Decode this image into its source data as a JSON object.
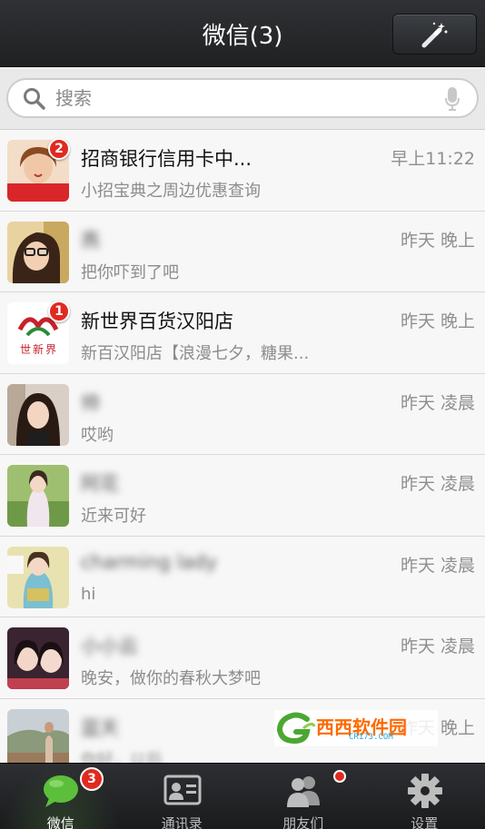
{
  "header": {
    "title": "微信(3)",
    "magic_icon": "magic-wand-icon"
  },
  "search": {
    "placeholder": "搜索",
    "value": "",
    "icon": "search-icon",
    "mic_icon": "microphone-icon"
  },
  "chats": [
    {
      "name": "招商银行信用卡中...",
      "message": "小招宝典之周边优惠查询",
      "time": "早上11:22",
      "badge": "2",
      "name_blurred": false,
      "msg_blurred": false
    },
    {
      "name": "燕",
      "message": "把你吓到了吧",
      "time": "昨天 晚上",
      "badge": "",
      "name_blurred": true,
      "msg_blurred": false
    },
    {
      "name": "新世界百货汉阳店",
      "message": "新百汉阳店【浪漫七夕，糖果...",
      "time": "昨天 晚上",
      "badge": "1",
      "name_blurred": false,
      "msg_blurred": false
    },
    {
      "name": "帅",
      "message": "哎哟",
      "time": "昨天 凌晨",
      "badge": "",
      "name_blurred": true,
      "msg_blurred": false
    },
    {
      "name": "阿花",
      "message": "近来可好",
      "time": "昨天 凌晨",
      "badge": "",
      "name_blurred": true,
      "msg_blurred": false
    },
    {
      "name": "charming lady",
      "message": "hi",
      "time": "昨天 凌晨",
      "badge": "",
      "name_blurred": true,
      "msg_blurred": false
    },
    {
      "name": "小小云",
      "message": "晚安，做你的春秋大梦吧",
      "time": "昨天 凌晨",
      "badge": "",
      "name_blurred": true,
      "msg_blurred": false
    },
    {
      "name": "蓝天",
      "message": "你好，以后",
      "time": "昨天 晚上",
      "badge": "",
      "name_blurred": true,
      "msg_blurred": true
    }
  ],
  "watermark": {
    "text": "西西软件园",
    "url": "CR173.COM"
  },
  "tabs": [
    {
      "label": "微信",
      "icon": "chat-bubble-icon",
      "badge": "3",
      "active": true
    },
    {
      "label": "通讯录",
      "icon": "contacts-card-icon",
      "badge": "",
      "active": false
    },
    {
      "label": "朋友们",
      "icon": "friends-icon",
      "badge": "",
      "active": false
    },
    {
      "label": "设置",
      "icon": "gear-icon",
      "badge": "",
      "active": false
    }
  ],
  "colors": {
    "header_bg": "#2a2c2f",
    "badge": "#e02a20",
    "active_tab_icon": "#5cbf3c"
  }
}
